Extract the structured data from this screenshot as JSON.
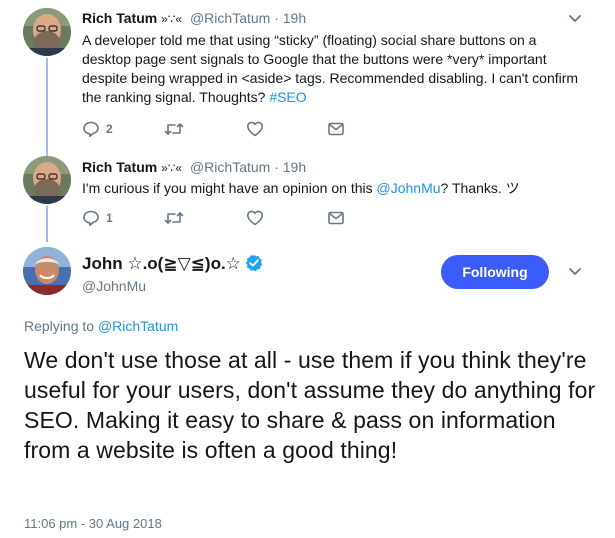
{
  "colors": {
    "accent": "#1b95e0",
    "follow_button": "#3b5bfb",
    "thread_line": "#a9b7f5",
    "muted": "#657786"
  },
  "tweets": [
    {
      "name": "Rich Tatum",
      "name_suffix": "»∵«",
      "handle": "@RichTatum",
      "dot": "·",
      "time": "19h",
      "text_before_tag": "A developer told me that using “sticky” (floating) social share buttons on a desktop page sent signals to Google that the buttons were *very* important despite being wrapped in <aside> tags. Recommended disabling. I can't confirm the ranking signal. Thoughts? ",
      "hashtag": "#SEO",
      "reply_count": "2",
      "retweet_count": "",
      "like_count": ""
    },
    {
      "name": "Rich Tatum",
      "name_suffix": "»∵«",
      "handle": "@RichTatum",
      "dot": "·",
      "time": "19h",
      "text_before_mention": "I'm curious if you might have an opinion on this ",
      "mention": "@JohnMu",
      "text_after_mention": "? Thanks. ツ",
      "reply_count": "1",
      "retweet_count": "",
      "like_count": ""
    }
  ],
  "main_tweet": {
    "name": "John ☆.o(≧▽≦)o.☆",
    "handle": "@JohnMu",
    "follow_label": "Following",
    "replying_prefix": "Replying to ",
    "replying_to": "@RichTatum",
    "text": "We don't use those at all - use them if you think they're useful for your users, don't assume they do anything for SEO. Making it easy to share & pass on information from a website is often a good thing!",
    "timestamp": "11:06 pm - 30 Aug 2018"
  },
  "icons": [
    "reply-icon",
    "retweet-icon",
    "like-icon",
    "dm-icon",
    "chevron-down-icon",
    "verified-badge-icon"
  ]
}
